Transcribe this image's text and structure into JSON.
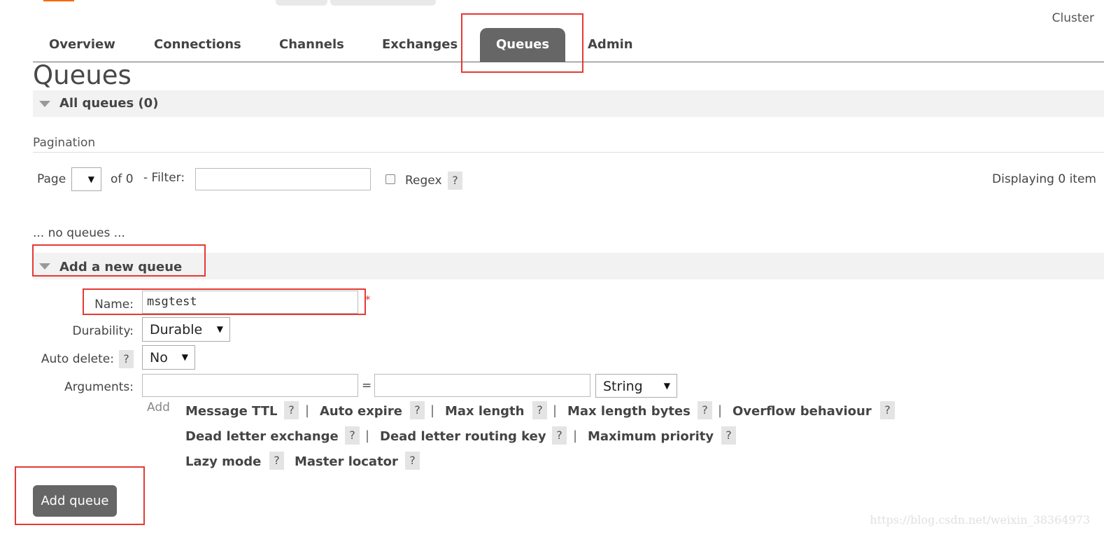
{
  "header": {
    "cluster_label": "Cluster"
  },
  "tabs": [
    {
      "label": "Overview"
    },
    {
      "label": "Connections"
    },
    {
      "label": "Channels"
    },
    {
      "label": "Exchanges"
    },
    {
      "label": "Queues",
      "active": true
    },
    {
      "label": "Admin"
    }
  ],
  "page_title": "Queues",
  "all_queues": {
    "title": "All queues (0)"
  },
  "pagination": {
    "section_label": "Pagination",
    "page_label": "Page",
    "page_value": "",
    "of_label": "of 0",
    "filter_label": "- Filter:",
    "filter_value": "",
    "regex_label": "Regex",
    "help": "?",
    "displaying": "Displaying 0 item"
  },
  "empty_message": "... no queues ...",
  "add_queue": {
    "title": "Add a new queue",
    "name_label": "Name:",
    "name_value": "msgtest",
    "required_mark": "*",
    "durability_label": "Durability:",
    "durability_value": "Durable",
    "auto_delete_label": "Auto delete:",
    "auto_delete_value": "No",
    "arguments_label": "Arguments:",
    "equals": "=",
    "arg_type_value": "String",
    "add_label": "Add",
    "help": "?",
    "pipe": "|",
    "shortcuts_row1": [
      "Message TTL",
      "Auto expire",
      "Max length",
      "Max length bytes",
      "Overflow behaviour"
    ],
    "shortcuts_row2": [
      "Dead letter exchange",
      "Dead letter routing key",
      "Maximum priority"
    ],
    "shortcuts_row3": [
      "Lazy mode",
      "Master locator"
    ],
    "submit_label": "Add queue"
  },
  "watermark": "https://blog.csdn.net/weixin_38364973",
  "colors": {
    "accent": "#ff6600",
    "tab_active": "#666666",
    "annotation": "#e53935"
  }
}
